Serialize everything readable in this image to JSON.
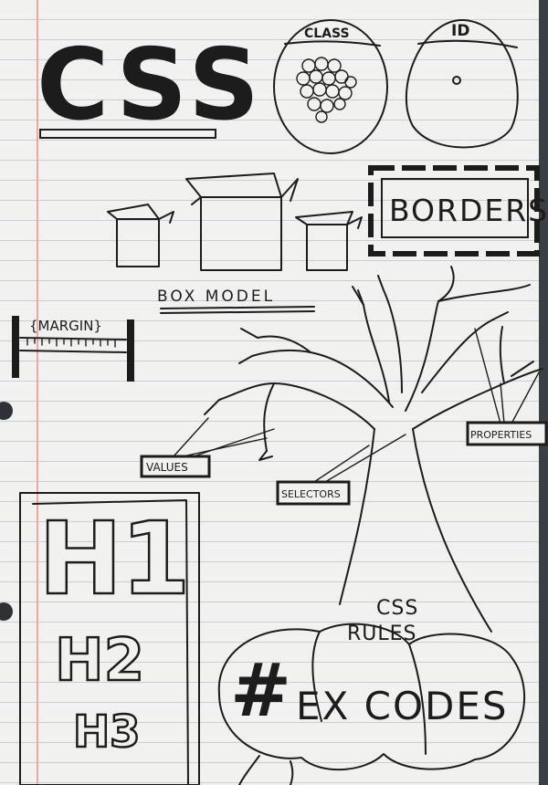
{
  "labels": {
    "title": "CSS",
    "class": "CLASS",
    "id": "ID",
    "borders": "BORDERS",
    "box_model": "BOX MODEL",
    "margin": "{MARGIN}",
    "values": "VALUES",
    "selectors": "SELECTORS",
    "properties": "PROPERTIES",
    "h1": "H1",
    "h2": "H2",
    "h3": "H3",
    "css_rules_line1": "CSS",
    "css_rules_line2": "RULES",
    "hash": "#",
    "hex_codes": "EX CODES"
  }
}
